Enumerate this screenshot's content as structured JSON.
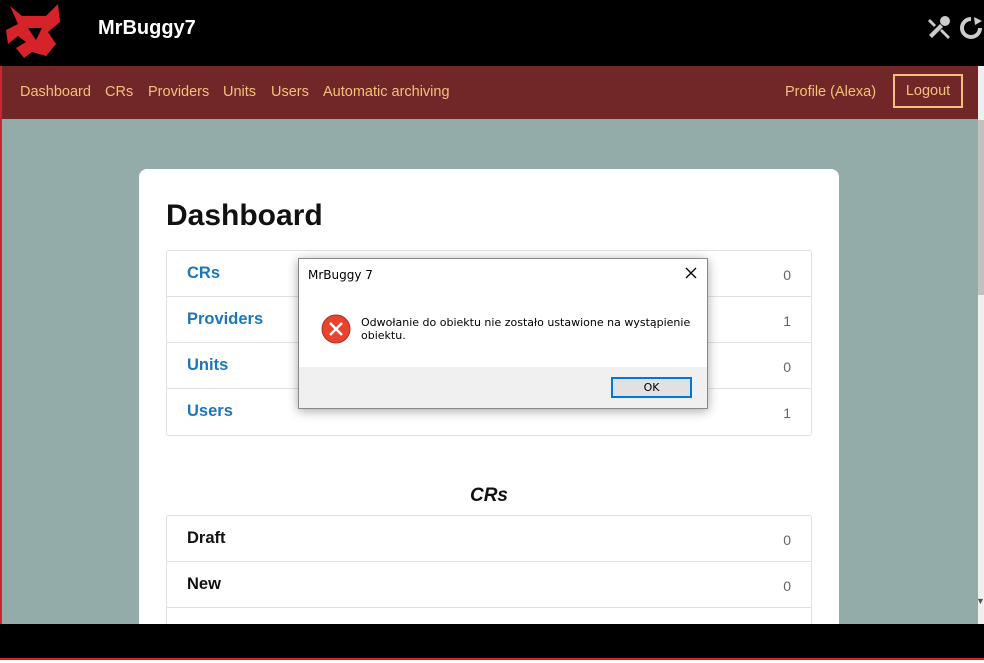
{
  "header": {
    "app_title": "MrBuggy7"
  },
  "nav": {
    "items": [
      "Dashboard",
      "CRs",
      "Providers",
      "Units",
      "Users",
      "Automatic archiving"
    ],
    "profile": "Profile (Alexa)",
    "logout": "Logout"
  },
  "page": {
    "title": "Dashboard",
    "summary": [
      {
        "label": "CRs",
        "count": "0"
      },
      {
        "label": "Providers",
        "count": "1"
      },
      {
        "label": "Units",
        "count": "0"
      },
      {
        "label": "Users",
        "count": "1"
      }
    ],
    "crs_section_title": "CRs",
    "crs_rows": [
      {
        "label": "Draft",
        "count": "0"
      },
      {
        "label": "New",
        "count": "0"
      }
    ]
  },
  "dialog": {
    "title": "MrBuggy 7",
    "message": "Odwołanie do obiektu nie zostało ustawione na wystąpienie obiektu.",
    "ok_label": "OK"
  },
  "colors": {
    "nav_bg": "#712628",
    "nav_text": "#f2c27a",
    "content_bg": "#93acaa",
    "link": "#1b77b8"
  }
}
